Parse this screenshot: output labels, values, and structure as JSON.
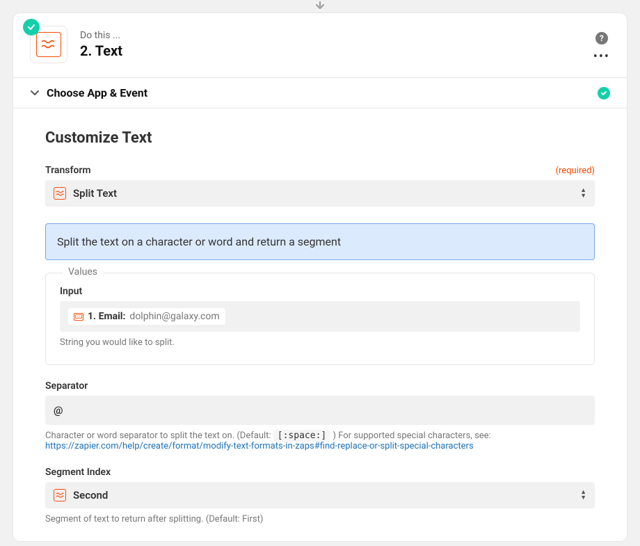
{
  "header": {
    "do_this": "Do this ...",
    "step_name": "2. Text"
  },
  "section": {
    "title": "Choose App & Event"
  },
  "customize": {
    "heading": "Customize Text",
    "transform": {
      "label": "Transform",
      "required": "(required)",
      "value": "Split Text"
    },
    "info": "Split the text on a character or word and return a segment",
    "values": {
      "legend": "Values",
      "input": {
        "label": "Input",
        "pill_label": "1. Email:",
        "pill_value": "dolphin@galaxy.com",
        "helper": "String you would like to split."
      }
    },
    "separator": {
      "label": "Separator",
      "value": "@",
      "helper_pre": "Character or word separator to split the text on. (Default: ",
      "helper_code": "[:space:]",
      "helper_post": " ) For supported special characters, see:",
      "helper_link": "https://zapier.com/help/create/format/modify-text-formats-in-zaps#find-replace-or-split-special-characters"
    },
    "segment_index": {
      "label": "Segment Index",
      "value": "Second",
      "helper": "Segment of text to return after splitting. (Default: First)"
    }
  }
}
